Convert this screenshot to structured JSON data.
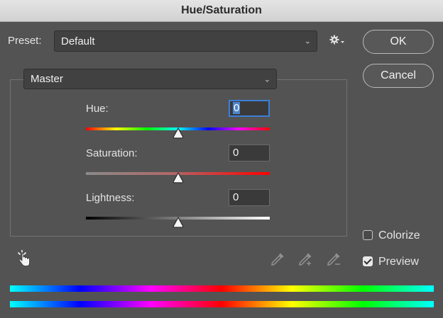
{
  "window": {
    "title": "Hue/Saturation"
  },
  "preset": {
    "label": "Preset:",
    "value": "Default",
    "gear_icon": "gear-icon"
  },
  "buttons": {
    "ok": "OK",
    "cancel": "Cancel"
  },
  "channel": {
    "value": "Master"
  },
  "hue": {
    "label": "Hue:",
    "value": "0",
    "slider_level": 0.5
  },
  "saturation": {
    "label": "Saturation:",
    "value": "0",
    "slider_level": 0.5
  },
  "lightness": {
    "label": "Lightness:",
    "value": "0",
    "slider_level": 0.5
  },
  "colorize": {
    "label": "Colorize",
    "checked": false
  },
  "preview": {
    "label": "Preview",
    "checked": true
  },
  "icons": {
    "targeted_adjustment": "hand-pointer-icon",
    "eyedropper": "eyedropper-icon",
    "eyedropper_add": "eyedropper-plus-icon",
    "eyedropper_subtract": "eyedropper-minus-icon"
  },
  "colors": {
    "focus_ring": "#3c7fd8",
    "dialog_bg": "#535353"
  }
}
